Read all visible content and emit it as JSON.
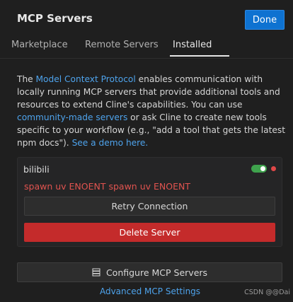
{
  "header": {
    "title": "MCP Servers",
    "done_label": "Done"
  },
  "tabs": [
    {
      "label": "Marketplace",
      "active": false
    },
    {
      "label": "Remote Servers",
      "active": false
    },
    {
      "label": "Installed",
      "active": true
    }
  ],
  "description": {
    "part1": "The ",
    "link1": "Model Context Protocol",
    "part2": " enables communication with locally running MCP servers that provide additional tools and resources to extend Cline's capabilities. You can use ",
    "link2": "community-made servers",
    "part3": " or ask Cline to create new tools specific to your workflow (e.g., \"add a tool that gets the latest npm docs\"). ",
    "link3": "See a demo here."
  },
  "server": {
    "name": "bilibili",
    "enabled": true,
    "status_color": "#e04848",
    "error": "spawn uv ENOENT spawn uv ENOENT",
    "retry_label": "Retry Connection",
    "delete_label": "Delete Server"
  },
  "footer": {
    "configure_label": "Configure MCP Servers",
    "configure_icon": "server-icon",
    "advanced_label": "Advanced MCP Settings"
  },
  "watermark": "CSDN @@Dai",
  "colors": {
    "accent": "#0e72d1",
    "link": "#4ea3ec",
    "error": "#e0534f",
    "danger": "#c42b2b",
    "toggle_on": "#3fa34d"
  }
}
